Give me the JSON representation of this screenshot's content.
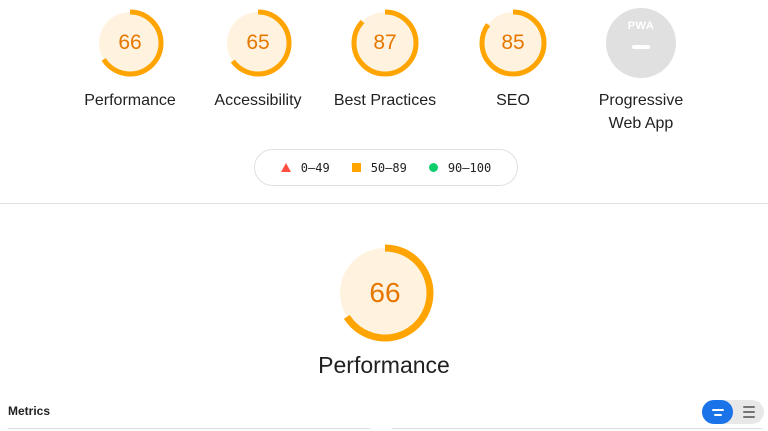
{
  "categories": [
    {
      "id": "performance",
      "score": "66",
      "score_value": 66,
      "label": "Performance",
      "color": "#ffa400"
    },
    {
      "id": "accessibility",
      "score": "65",
      "score_value": 65,
      "label": "Accessibility",
      "color": "#ffa400"
    },
    {
      "id": "best-practices",
      "score": "87",
      "score_value": 87,
      "label": "Best Practices",
      "color": "#ffa400"
    },
    {
      "id": "seo",
      "score": "85",
      "score_value": 85,
      "label": "SEO",
      "color": "#ffa400"
    }
  ],
  "pwa": {
    "badge_text": "PWA",
    "label_line1": "Progressive",
    "label_line2": "Web App"
  },
  "legend": [
    {
      "shape": "triangle",
      "range": "0–49",
      "color": "#ff4e42"
    },
    {
      "shape": "square",
      "range": "50–89",
      "color": "#ffa400"
    },
    {
      "shape": "circle",
      "range": "90–100",
      "color": "#0cce6b"
    }
  ],
  "main": {
    "score": "66",
    "score_value": 66,
    "title": "Performance",
    "color": "#ffa400"
  },
  "metrics": {
    "title": "Metrics",
    "view_toggle": {
      "active": "expanded-view",
      "inactive": "compact-view"
    }
  },
  "colors": {
    "average": "#ffa400",
    "average_text": "#e67700",
    "average_fill": "#fff3e0",
    "toggle_active": "#1a73e8"
  }
}
